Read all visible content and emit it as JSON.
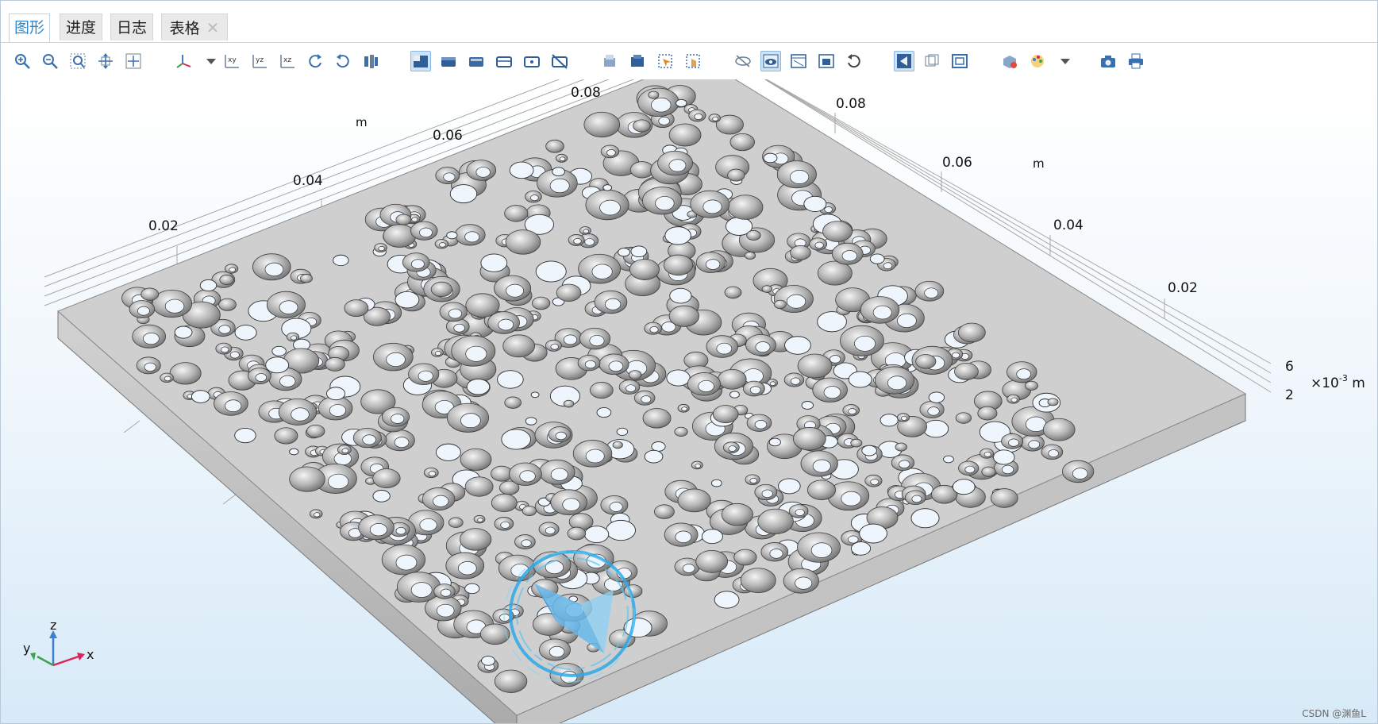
{
  "tabs": [
    {
      "label": "图形",
      "active": true
    },
    {
      "label": "进度",
      "active": false
    },
    {
      "label": "日志",
      "active": false
    },
    {
      "label": "表格",
      "active": false,
      "closable": true,
      "close_glyph": "✕"
    }
  ],
  "toolbar": {
    "groups": [
      [
        "zoom-in-icon",
        "zoom-out-icon",
        "zoom-box-icon",
        "zoom-extents-icon",
        "zoom-selection-icon"
      ],
      [
        "axis-orientation-icon",
        "dropdown-arrow-icon",
        "view-xy-icon",
        "view-yz-icon",
        "view-xz-icon",
        "rotate-right-icon",
        "rotate-left-icon",
        "move-icon"
      ],
      [
        "select-box-icon",
        "select-domain-icon",
        "select-boundary-icon",
        "select-edge-icon",
        "select-point-icon",
        "deselect-icon"
      ],
      [
        "clear-selection-icon",
        "highlight-icon",
        "zoom-to-selection-icon",
        "pick-icon"
      ],
      [
        "hide-icon",
        "show-icon",
        "wireframe-icon",
        "render-icon",
        "reset-view-icon"
      ],
      [
        "transparency-icon",
        "mesh-view-icon",
        "frame-icon"
      ],
      [
        "scene-light-icon",
        "color-palette-icon",
        "dropdown-arrow-icon"
      ],
      [
        "camera-icon",
        "print-icon"
      ]
    ],
    "toggled": [
      "select-box-icon",
      "show-icon",
      "transparency-icon"
    ],
    "labels": {
      "xy": "xy",
      "yz": "yz",
      "xz": "xz"
    }
  },
  "axes": {
    "left_ticks": [
      "0.02",
      "0.04",
      "0.06",
      "0.08"
    ],
    "left_unit": "m",
    "right_ticks": [
      "0.08",
      "0.06",
      "0.04",
      "0.02"
    ],
    "right_unit": "m",
    "z_ticks": [
      "6",
      "2"
    ],
    "z_unit_base": "×10",
    "z_unit_exp": "-3",
    "z_unit_suffix": " m"
  },
  "triad": {
    "x": "x",
    "y": "y",
    "z": "z"
  },
  "colors": {
    "tab_active": "#2f86c7",
    "plate": "#c9c9c9",
    "plate_side": "#bdbdbd",
    "hole": "#eef5fc",
    "sphere": "#a6a6a6",
    "triad_x": "#d9245c",
    "triad_y": "#3da44a",
    "triad_z": "#3c7fd1",
    "logo": "#2aa9e8"
  },
  "watermark": "CSDN @渊鱼L"
}
